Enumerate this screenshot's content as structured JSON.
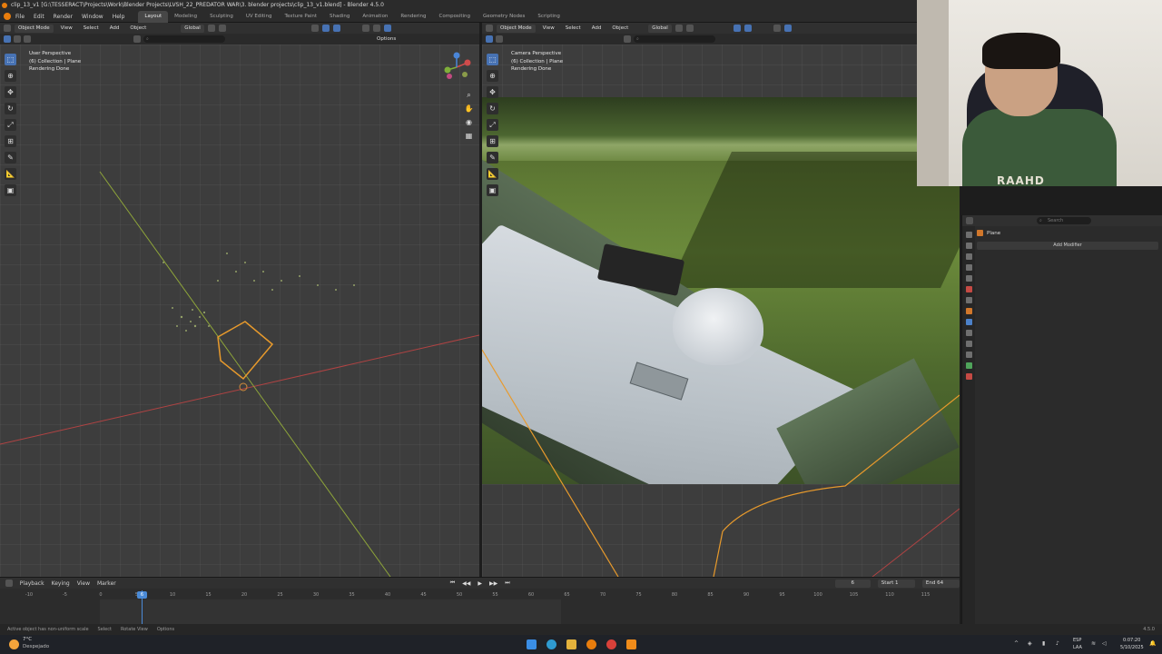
{
  "window": {
    "title": "clip_13_v1 [G:\\TESSERACT\\Projects\\Work\\Blender Projects\\LVSH_22_PREDATOR WAR\\3. blender projects\\clip_13_v1.blend] - Blender 4.5.0"
  },
  "menu": {
    "items": [
      "File",
      "Edit",
      "Render",
      "Window",
      "Help"
    ],
    "workspaces": [
      "Layout",
      "Modeling",
      "Sculpting",
      "UV Editing",
      "Texture Paint",
      "Shading",
      "Animation",
      "Rendering",
      "Compositing",
      "Geometry Nodes",
      "Scripting"
    ],
    "active_workspace": "Layout"
  },
  "viewport_left": {
    "mode": "Object Mode",
    "menus": [
      "View",
      "Select",
      "Add",
      "Object"
    ],
    "orientation": "Global",
    "options": "Options",
    "info": [
      "User Perspective",
      "(6) Collection | Plane",
      "Rendering Done"
    ]
  },
  "viewport_right": {
    "mode": "Object Mode",
    "menus": [
      "View",
      "Select",
      "Add",
      "Object"
    ],
    "orientation": "Global",
    "info": [
      "Camera Perspective",
      "(6) Collection | Plane",
      "Rendering Done"
    ]
  },
  "properties": {
    "search_placeholder": "Search",
    "object_name": "Plane",
    "add_modifier": "Add Modifier"
  },
  "webcam": {
    "shirt_text": "RAAHD"
  },
  "timeline": {
    "menus": [
      "Playback",
      "Keying",
      "View",
      "Marker"
    ],
    "current_frame": "6",
    "start_label": "Start",
    "start_value": "1",
    "end_label": "End",
    "end_value": "64",
    "ticks": [
      "-10",
      "-5",
      "0",
      "5",
      "10",
      "15",
      "20",
      "25",
      "30",
      "35",
      "40",
      "45",
      "50",
      "55",
      "60",
      "65",
      "70",
      "75",
      "80",
      "85",
      "90",
      "95",
      "100",
      "105",
      "110",
      "115"
    ]
  },
  "statusbar": {
    "warning": "Active object has non-uniform scale",
    "select": "Select",
    "rotate": "Rotate View",
    "options": "Options",
    "version": "4.5.0"
  },
  "taskbar": {
    "weather_temp": "7°C",
    "weather_desc": "Despejado",
    "lang": "ESP",
    "lang2": "LAA",
    "time": "0:07:20",
    "date": "5/10/2025"
  }
}
